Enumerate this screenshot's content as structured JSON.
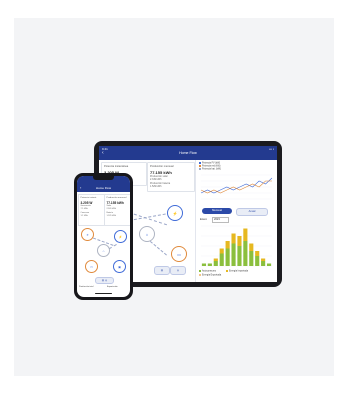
{
  "ipad": {
    "status_time": "9:41",
    "status_right": "••• ▪",
    "title": "Home Flow",
    "stats": [
      {
        "label": "Potencia instantánea",
        "value": "3.205 W",
        "subs": [
          "Potencia generación",
          "Consumo"
        ]
      },
      {
        "label": "Producción mensual",
        "value": "77.155 kWh",
        "subs": [
          "Producción solar",
          "2.349 kWh",
          "Producción batería",
          "1.529 kWh"
        ]
      }
    ],
    "line_legend": [
      {
        "name": "Potencia FV (kW)",
        "color": "#3f6bd8"
      },
      {
        "name": "Potencia red (kW)",
        "color": "#e08a3c"
      },
      {
        "name": "Potencia bat. (kW)",
        "color": "#9aa6c8"
      },
      {
        "name": "Potencia carga",
        "color": "#6fb33d"
      }
    ],
    "buttons": [
      "Mensual",
      "Anual"
    ],
    "period_label": "Enero",
    "period_value": "2023",
    "bar_legend": [
      "Autoconsumo",
      "Energía Importada",
      "Energía Exportada"
    ]
  },
  "phone": {
    "title": "Home Flow",
    "stats": [
      {
        "label": "Potencia instant.",
        "value": "3.205 W",
        "subs": [
          "Generación",
          "7.5 kWh",
          "Consumo",
          "1.2 kWh"
        ]
      },
      {
        "label": "Producción mensual",
        "value": "77.155 kWh",
        "subs": [
          "Solar",
          "2.349 kWh",
          "Batería",
          "1.529 kWh"
        ]
      }
    ],
    "bottom_labels": [
      "Producción total",
      "Exportación"
    ]
  },
  "colors": {
    "header": "#233a8f",
    "accent_orange": "#e08a3c",
    "accent_blue": "#3f6bd8",
    "bar_green": "#8bbf3d",
    "bar_yellow": "#e6b820"
  },
  "chart_data": [
    {
      "type": "line",
      "title": "",
      "series": [
        {
          "name": "Potencia FV (kW)",
          "values": [
            2,
            3,
            2,
            3,
            4,
            3,
            4,
            5,
            4,
            6,
            5,
            7
          ]
        },
        {
          "name": "Potencia red (kW)",
          "values": [
            3,
            2,
            3,
            2,
            3,
            4,
            3,
            4,
            5,
            4,
            6,
            6
          ]
        }
      ],
      "ylim": [
        0,
        8
      ]
    },
    {
      "type": "bar",
      "title": "",
      "categories": [
        "1",
        "2",
        "3",
        "4",
        "5",
        "6",
        "7",
        "8",
        "9",
        "10",
        "11",
        "12"
      ],
      "series": [
        {
          "name": "Autoconsumo",
          "values": [
            1,
            1,
            2,
            5,
            7,
            9,
            8,
            10,
            6,
            4,
            2,
            1
          ]
        },
        {
          "name": "Energía Importada",
          "values": [
            0,
            0,
            1,
            2,
            3,
            4,
            4,
            5,
            3,
            2,
            1,
            0
          ]
        }
      ],
      "ylim": [
        0,
        16
      ]
    }
  ]
}
